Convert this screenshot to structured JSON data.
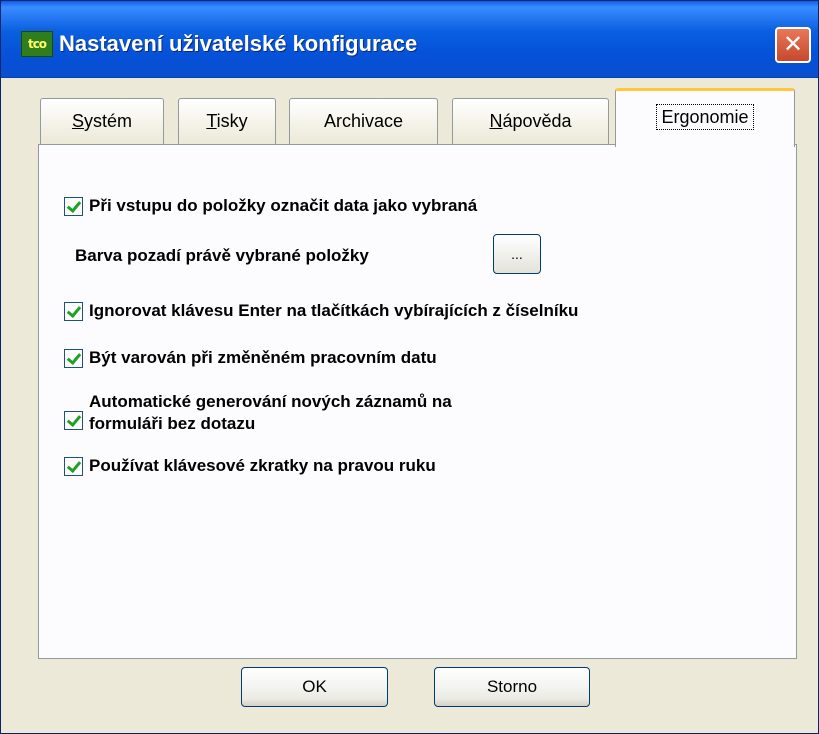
{
  "window": {
    "icon_text": "tco",
    "title": "Nastavení uživatelské konfigurace",
    "close_label": "✕"
  },
  "tabs": [
    {
      "label": "Systém",
      "active": false
    },
    {
      "label": "Tisky",
      "active": false
    },
    {
      "label": "Archivace",
      "active": false
    },
    {
      "label": "Nápověda",
      "active": false
    },
    {
      "label": "Ergonomie",
      "active": true
    }
  ],
  "ergonomie": {
    "option_select_on_enter": {
      "label": "Při vstupu do položky označit data jako vybraná",
      "checked": true
    },
    "color_label": "Barva pozadí právě vybrané položky",
    "color_button_label": "...",
    "option_ignore_enter": {
      "label": "Ignorovat klávesu Enter na tlačítkách vybírajících z číselníku",
      "checked": true
    },
    "option_warn_date": {
      "label": "Být varován při změněném pracovním datu",
      "checked": true
    },
    "option_auto_generate": {
      "label_line1": "Automatické generování nových záznamů na",
      "label_line2": "formuláři bez dotazu",
      "checked": true
    },
    "option_right_hand": {
      "label": "Používat klávesové zkratky na pravou ruku",
      "checked": true
    }
  },
  "buttons": {
    "ok": "OK",
    "cancel": "Storno"
  },
  "colors": {
    "titlebar": "#0a5fe8",
    "check": "#21a121",
    "active_tab_accent": "#ffc83c"
  }
}
